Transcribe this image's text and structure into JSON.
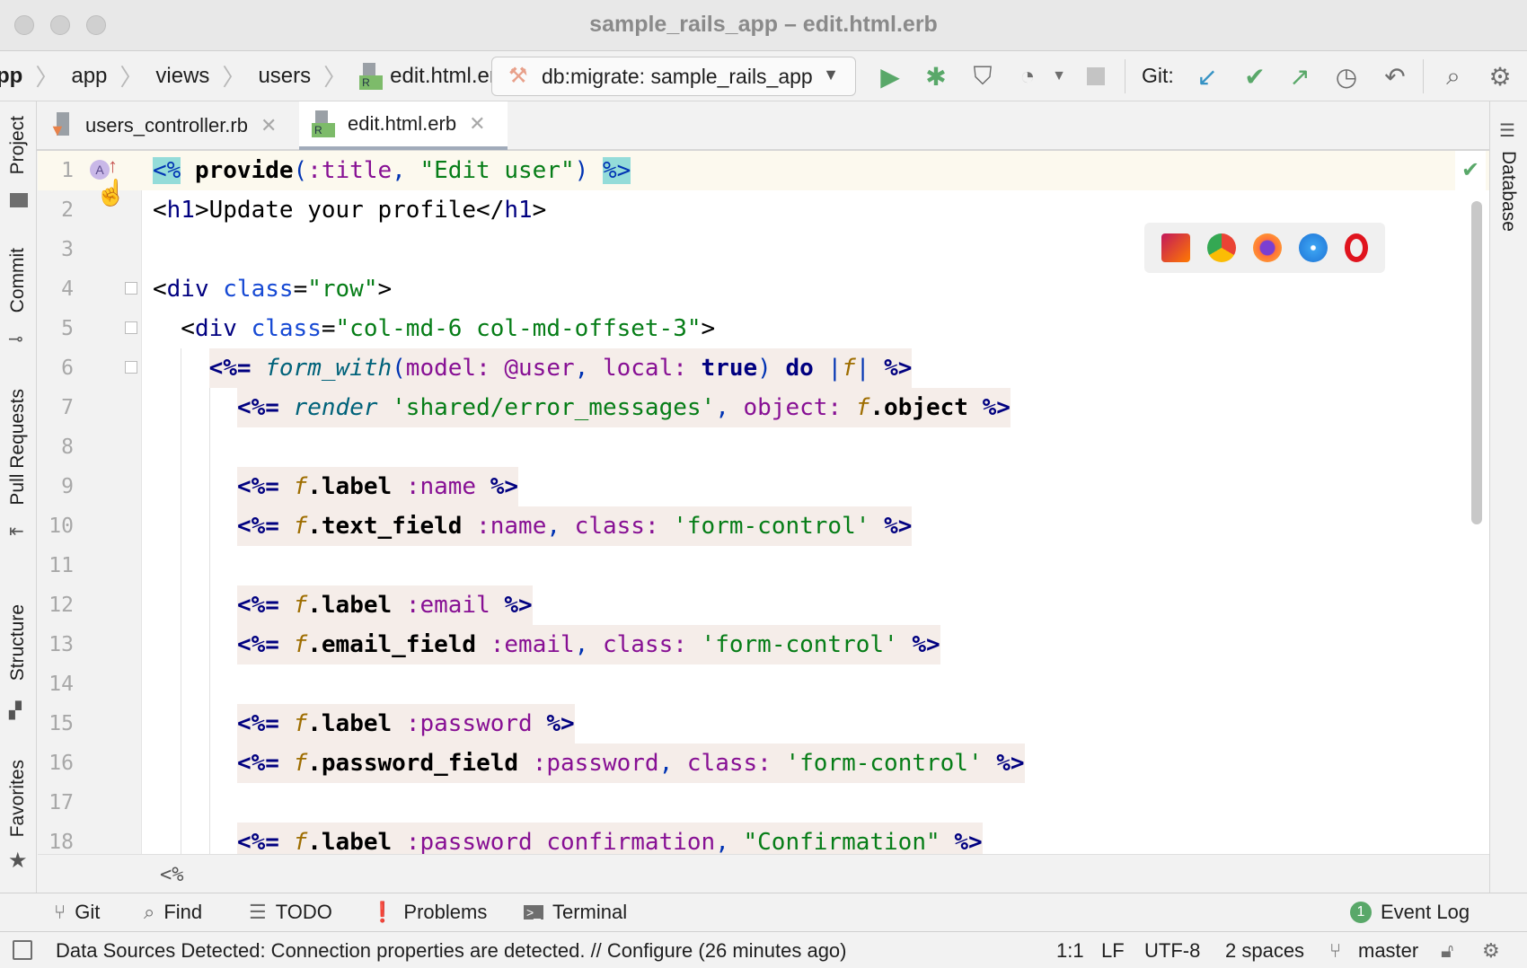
{
  "window": {
    "title": "sample_rails_app – edit.html.erb"
  },
  "breadcrumb": [
    "pp",
    "app",
    "views",
    "users",
    "edit.html.erb"
  ],
  "run_config": {
    "label": "db:migrate: sample_rails_app"
  },
  "toolbar": {
    "git_label": "Git:"
  },
  "tabs": [
    {
      "label": "users_controller.rb",
      "active": false
    },
    {
      "label": "edit.html.erb",
      "active": true
    }
  ],
  "left_tools": [
    "Project",
    "Commit",
    "Pull Requests",
    "Structure",
    "Favorites"
  ],
  "right_tools": [
    "Database"
  ],
  "editor": {
    "current_line": 1,
    "lines": [
      {
        "n": "1",
        "tokens": [
          [
            "<%",
            "erb"
          ],
          [
            " ",
            "pl"
          ],
          [
            "provide",
            "id"
          ],
          [
            "(",
            "p"
          ],
          [
            ":title",
            "sym"
          ],
          [
            ", ",
            "p"
          ],
          [
            "\"Edit user\"",
            "str"
          ],
          [
            ")",
            "p"
          ],
          [
            " ",
            "pl"
          ],
          [
            "%>",
            "erb"
          ]
        ]
      },
      {
        "n": "2",
        "tokens": [
          [
            "<",
            "pl"
          ],
          [
            "h1",
            "tag"
          ],
          [
            ">Update your profile</",
            "pl"
          ],
          [
            "h1",
            "tag"
          ],
          [
            ">",
            "pl"
          ]
        ]
      },
      {
        "n": "3",
        "tokens": []
      },
      {
        "n": "4",
        "tokens": [
          [
            "<",
            "pl"
          ],
          [
            "div",
            "tag"
          ],
          [
            " ",
            "pl"
          ],
          [
            "class",
            "attr"
          ],
          [
            "=",
            "pl"
          ],
          [
            "\"row\"",
            "str"
          ],
          [
            ">",
            "pl"
          ]
        ]
      },
      {
        "n": "5",
        "tokens": [
          [
            "  <",
            "pl"
          ],
          [
            "div",
            "tag"
          ],
          [
            " ",
            "pl"
          ],
          [
            "class",
            "attr"
          ],
          [
            "=",
            "pl"
          ],
          [
            "\"col-md-6 col-md-offset-3\"",
            "str"
          ],
          [
            ">",
            "pl"
          ]
        ]
      },
      {
        "n": "6",
        "indent": 4,
        "tokens": [
          [
            "<%=",
            "erbn"
          ],
          [
            " ",
            "pl"
          ],
          [
            "form_with",
            "meth"
          ],
          [
            "(",
            "p"
          ],
          [
            "model: ",
            "sym"
          ],
          [
            "@user",
            "sym"
          ],
          [
            ", ",
            "p"
          ],
          [
            "local: ",
            "sym"
          ],
          [
            "true",
            "kw"
          ],
          [
            ") ",
            "p"
          ],
          [
            "do",
            "kw"
          ],
          [
            " |",
            "p"
          ],
          [
            "f",
            "f"
          ],
          [
            "| ",
            "p"
          ],
          [
            "%>",
            "erbn"
          ]
        ]
      },
      {
        "n": "7",
        "indent": 6,
        "tokens": [
          [
            "<%=",
            "erbn"
          ],
          [
            " ",
            "pl"
          ],
          [
            "render",
            "meth"
          ],
          [
            " ",
            "pl"
          ],
          [
            "'shared/error_messages'",
            "str"
          ],
          [
            ", ",
            "p"
          ],
          [
            "object: ",
            "sym"
          ],
          [
            "f",
            "f"
          ],
          [
            ".object ",
            "id"
          ],
          [
            "%>",
            "erbn"
          ]
        ]
      },
      {
        "n": "8",
        "tokens": []
      },
      {
        "n": "9",
        "indent": 6,
        "tokens": [
          [
            "<%=",
            "erbn"
          ],
          [
            " ",
            "pl"
          ],
          [
            "f",
            "f"
          ],
          [
            ".label ",
            "id"
          ],
          [
            ":name ",
            "sym"
          ],
          [
            "%>",
            "erbn"
          ]
        ]
      },
      {
        "n": "10",
        "indent": 6,
        "tokens": [
          [
            "<%=",
            "erbn"
          ],
          [
            " ",
            "pl"
          ],
          [
            "f",
            "f"
          ],
          [
            ".text_field ",
            "id"
          ],
          [
            ":name",
            "sym"
          ],
          [
            ", ",
            "p"
          ],
          [
            "class: ",
            "sym"
          ],
          [
            "'form-control'",
            "str"
          ],
          [
            " ",
            "pl"
          ],
          [
            "%>",
            "erbn"
          ]
        ]
      },
      {
        "n": "11",
        "tokens": []
      },
      {
        "n": "12",
        "indent": 6,
        "tokens": [
          [
            "<%=",
            "erbn"
          ],
          [
            " ",
            "pl"
          ],
          [
            "f",
            "f"
          ],
          [
            ".label ",
            "id"
          ],
          [
            ":email ",
            "sym"
          ],
          [
            "%>",
            "erbn"
          ]
        ]
      },
      {
        "n": "13",
        "indent": 6,
        "tokens": [
          [
            "<%=",
            "erbn"
          ],
          [
            " ",
            "pl"
          ],
          [
            "f",
            "f"
          ],
          [
            ".email_field ",
            "id"
          ],
          [
            ":email",
            "sym"
          ],
          [
            ", ",
            "p"
          ],
          [
            "class: ",
            "sym"
          ],
          [
            "'form-control'",
            "str"
          ],
          [
            " ",
            "pl"
          ],
          [
            "%>",
            "erbn"
          ]
        ]
      },
      {
        "n": "14",
        "tokens": []
      },
      {
        "n": "15",
        "indent": 6,
        "tokens": [
          [
            "<%=",
            "erbn"
          ],
          [
            " ",
            "pl"
          ],
          [
            "f",
            "f"
          ],
          [
            ".label ",
            "id"
          ],
          [
            ":password ",
            "sym"
          ],
          [
            "%>",
            "erbn"
          ]
        ]
      },
      {
        "n": "16",
        "indent": 6,
        "tokens": [
          [
            "<%=",
            "erbn"
          ],
          [
            " ",
            "pl"
          ],
          [
            "f",
            "f"
          ],
          [
            ".password_field ",
            "id"
          ],
          [
            ":password",
            "sym"
          ],
          [
            ", ",
            "p"
          ],
          [
            "class: ",
            "sym"
          ],
          [
            "'form-control'",
            "str"
          ],
          [
            " ",
            "pl"
          ],
          [
            "%>",
            "erbn"
          ]
        ]
      },
      {
        "n": "17",
        "tokens": []
      },
      {
        "n": "18",
        "indent": 6,
        "tokens": [
          [
            "<%=",
            "erbn"
          ],
          [
            " ",
            "pl"
          ],
          [
            "f",
            "f"
          ],
          [
            ".label ",
            "id"
          ],
          [
            ":password_confirmation",
            "sym"
          ],
          [
            ", ",
            "p"
          ],
          [
            "\"Confirmation\"",
            "str"
          ],
          [
            " ",
            "pl"
          ],
          [
            "%>",
            "erbn"
          ]
        ]
      }
    ]
  },
  "editor_breadcrumb": "<%",
  "bottom_tools": [
    {
      "label": "Git",
      "icon": "git-icon"
    },
    {
      "label": "Find",
      "icon": "search-icon"
    },
    {
      "label": "TODO",
      "icon": "list-icon"
    },
    {
      "label": "Problems",
      "icon": "problems-icon"
    },
    {
      "label": "Terminal",
      "icon": "terminal-icon"
    }
  ],
  "event_log": {
    "label": "Event Log",
    "count": "1"
  },
  "status": {
    "message": "Data Sources Detected: Connection properties are detected. // Configure (26 minutes ago)",
    "position": "1:1",
    "line_ending": "LF",
    "encoding": "UTF-8",
    "indent": "2 spaces",
    "branch": "master"
  },
  "colors": {
    "accent_green": "#59a869",
    "git_update_blue": "#3592c4",
    "erb_highlight": "#94dcd9",
    "erb_block_bg": "#f5ede9"
  }
}
